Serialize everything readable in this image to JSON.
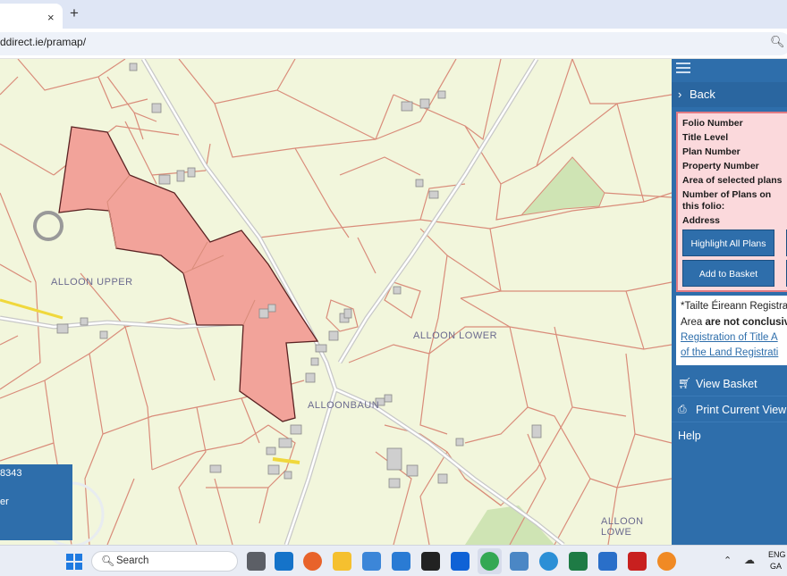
{
  "browser": {
    "tab_close": "×",
    "new_tab": "+",
    "url": "ddirect.ie/pramap/",
    "zoom_icon": "zoom-icon"
  },
  "map": {
    "townlands": [
      "ALLOON UPPER",
      "ALLOON LOWER",
      "ALLOONBAUN",
      "ALLOON LOWE"
    ],
    "selected_parcel_color": "#f2a39a",
    "boundary_color": "#d98c7a",
    "info_box": {
      "line1": "8343",
      "line2": "er"
    }
  },
  "panel": {
    "menu_icon": "hamburger-icon",
    "back_label": "Back",
    "details_labels": [
      "Folio Number",
      "Title Level",
      "Plan Number",
      "Property Number",
      "Area of selected plans",
      "Number of Plans on",
      "this folio:",
      "Address"
    ],
    "highlight_button": "Highlight All Plans",
    "basket_button": "Add to Basket",
    "disclaimer": {
      "line1": "*Tailte Éireann Registrati",
      "line2_prefix": "Area ",
      "line2_bold": "are not conclusive",
      "link1": "Registration of Title A",
      "link2": "of the Land Registrati"
    },
    "nav": [
      {
        "icon": "🛒",
        "label": "View Basket"
      },
      {
        "icon": "🖶",
        "label": "Print Current View"
      },
      {
        "icon": "",
        "label": "Help"
      }
    ]
  },
  "taskbar": {
    "search_placeholder": "Search",
    "lang_top": "ENG",
    "lang_bottom": "GA"
  }
}
